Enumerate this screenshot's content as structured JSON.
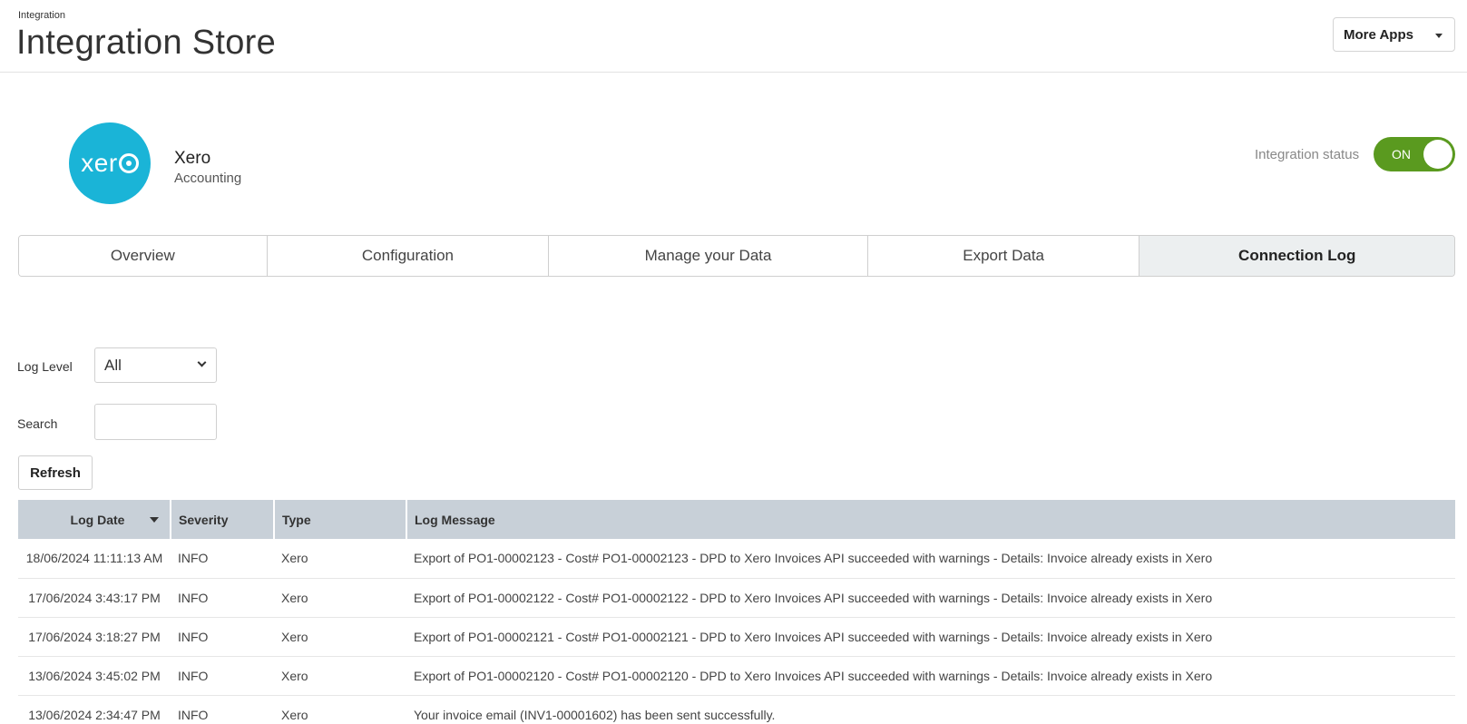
{
  "header": {
    "breadcrumb": "Integration",
    "title": "Integration Store",
    "more_apps_label": "More Apps"
  },
  "app": {
    "logo_text": "xer",
    "name": "Xero",
    "category": "Accounting",
    "brand_color": "#1ab4d7"
  },
  "status": {
    "label": "Integration status",
    "toggle_text": "ON",
    "toggle_color": "#5a9a1f"
  },
  "tabs": [
    {
      "label": "Overview"
    },
    {
      "label": "Configuration"
    },
    {
      "label": "Manage your Data"
    },
    {
      "label": "Export Data"
    },
    {
      "label": "Connection Log"
    }
  ],
  "filters": {
    "log_level_label": "Log Level",
    "log_level_value": "All",
    "search_label": "Search",
    "search_value": "",
    "refresh_label": "Refresh"
  },
  "table": {
    "columns": [
      "Log Date",
      "Severity",
      "Type",
      "Log Message"
    ],
    "rows": [
      {
        "date": "18/06/2024 11:11:13 AM",
        "severity": "INFO",
        "type": "Xero",
        "message": "Export of PO1-00002123 - Cost# PO1-00002123 - DPD to Xero Invoices API succeeded with warnings - Details: Invoice already exists in Xero"
      },
      {
        "date": "17/06/2024 3:43:17 PM",
        "severity": "INFO",
        "type": "Xero",
        "message": "Export of PO1-00002122 - Cost# PO1-00002122 - DPD to Xero Invoices API succeeded with warnings - Details: Invoice already exists in Xero"
      },
      {
        "date": "17/06/2024 3:18:27 PM",
        "severity": "INFO",
        "type": "Xero",
        "message": "Export of PO1-00002121 - Cost# PO1-00002121 - DPD to Xero Invoices API succeeded with warnings - Details: Invoice already exists in Xero"
      },
      {
        "date": "13/06/2024 3:45:02 PM",
        "severity": "INFO",
        "type": "Xero",
        "message": "Export of PO1-00002120 - Cost# PO1-00002120 - DPD to Xero Invoices API succeeded with warnings - Details: Invoice already exists in Xero"
      },
      {
        "date": "13/06/2024 2:34:47 PM",
        "severity": "INFO",
        "type": "Xero",
        "message": "Your invoice email (INV1-00001602) has been sent successfully."
      }
    ]
  }
}
